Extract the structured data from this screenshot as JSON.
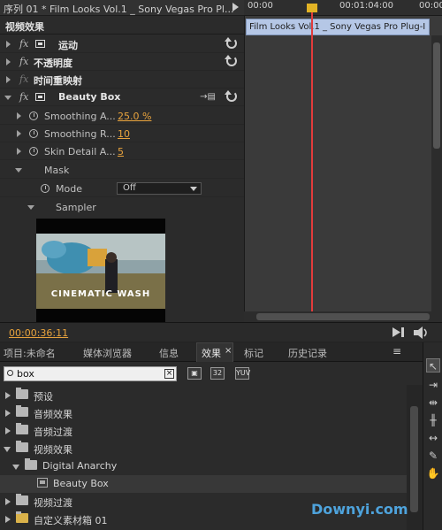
{
  "sequence": {
    "title": "序列 01 * Film Looks Vol.1 _ Sony Vegas Pro Pl..."
  },
  "effect_controls": {
    "header": "视频效果",
    "rows": [
      {
        "label": "运动"
      },
      {
        "label": "不透明度"
      },
      {
        "label": "时间重映射"
      },
      {
        "label": "Beauty Box"
      }
    ],
    "params": [
      {
        "label": "Smoothing A...",
        "value": "25.0 %"
      },
      {
        "label": "Smoothing R...",
        "value": "10"
      },
      {
        "label": "Skin Detail A...",
        "value": "5"
      }
    ],
    "mask_label": "Mask",
    "mode_label": "Mode",
    "mode_value": "Off",
    "sampler_label": "Sampler",
    "thumbnail_caption": "CINEMATIC WASH"
  },
  "timeline": {
    "ruler": [
      "00:00",
      "00:01:04:00",
      "00:00"
    ],
    "clip_label": "Film Looks Vol.1 _ Sony Vegas Pro Plug-I"
  },
  "timecode": "00:00:36:11",
  "tabs": [
    {
      "label": "项目:未命名"
    },
    {
      "label": "媒体浏览器"
    },
    {
      "label": "信息"
    },
    {
      "label": "效果"
    },
    {
      "label": "标记"
    },
    {
      "label": "历史记录"
    }
  ],
  "search": {
    "value": "box"
  },
  "filter_buttons": [
    "32",
    "YUV"
  ],
  "tree": [
    {
      "label": "预设"
    },
    {
      "label": "音频效果"
    },
    {
      "label": "音频过渡"
    },
    {
      "label": "视频效果"
    },
    {
      "label": "Digital Anarchy"
    },
    {
      "label": "Beauty Box"
    },
    {
      "label": "视频过渡"
    },
    {
      "label": "自定义素材箱 01"
    }
  ],
  "watermark": "Downyi.com",
  "colors": {
    "accent": "#e8a33d",
    "playhead": "#e23b3b",
    "clip": "#b5c7e6"
  }
}
